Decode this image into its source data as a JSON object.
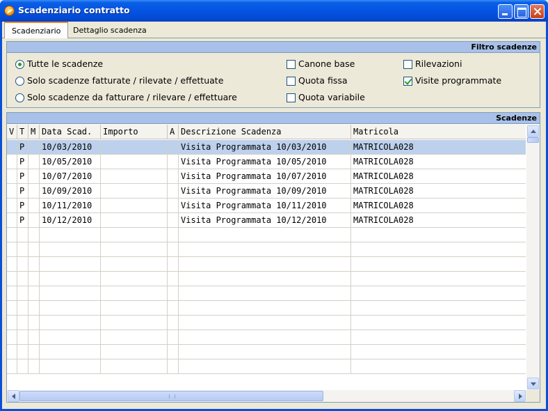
{
  "window": {
    "title": "Scadenziario contratto"
  },
  "tabs": [
    {
      "label": "Scadenziario",
      "active": true
    },
    {
      "label": "Dettaglio scadenza",
      "active": false
    }
  ],
  "filter": {
    "header": "Filtro scadenze",
    "radios": [
      {
        "label": "Tutte le scadenze",
        "checked": true
      },
      {
        "label": "Solo scadenze fatturate / rilevate / effettuate",
        "checked": false
      },
      {
        "label": "Solo scadenze da fatturare / rilevare / effettuare",
        "checked": false
      }
    ],
    "checks": [
      {
        "label": "Canone base",
        "checked": false
      },
      {
        "label": "Quota fissa",
        "checked": false
      },
      {
        "label": "Quota variabile",
        "checked": false
      },
      {
        "label": "Rilevazioni",
        "checked": false
      },
      {
        "label": "Visite programmate",
        "checked": true
      }
    ]
  },
  "grid": {
    "header": "Scadenze",
    "columns": [
      "V",
      "T",
      "M",
      "Data Scad.",
      "Importo",
      "A",
      "Descrizione Scadenza",
      "Matricola"
    ],
    "rows": [
      {
        "v": "",
        "t": "P",
        "m": "",
        "date": "10/03/2010",
        "importo": "",
        "a": "",
        "desc": "Visita Programmata 10/03/2010",
        "matricola": "MATRICOLA028",
        "selected": true
      },
      {
        "v": "",
        "t": "P",
        "m": "",
        "date": "10/05/2010",
        "importo": "",
        "a": "",
        "desc": "Visita Programmata 10/05/2010",
        "matricola": "MATRICOLA028",
        "selected": false
      },
      {
        "v": "",
        "t": "P",
        "m": "",
        "date": "10/07/2010",
        "importo": "",
        "a": "",
        "desc": "Visita Programmata 10/07/2010",
        "matricola": "MATRICOLA028",
        "selected": false
      },
      {
        "v": "",
        "t": "P",
        "m": "",
        "date": "10/09/2010",
        "importo": "",
        "a": "",
        "desc": "Visita Programmata 10/09/2010",
        "matricola": "MATRICOLA028",
        "selected": false
      },
      {
        "v": "",
        "t": "P",
        "m": "",
        "date": "10/11/2010",
        "importo": "",
        "a": "",
        "desc": "Visita Programmata 10/11/2010",
        "matricola": "MATRICOLA028",
        "selected": false
      },
      {
        "v": "",
        "t": "P",
        "m": "",
        "date": "10/12/2010",
        "importo": "",
        "a": "",
        "desc": "Visita Programmata 10/12/2010",
        "matricola": "MATRICOLA028",
        "selected": false
      }
    ]
  }
}
